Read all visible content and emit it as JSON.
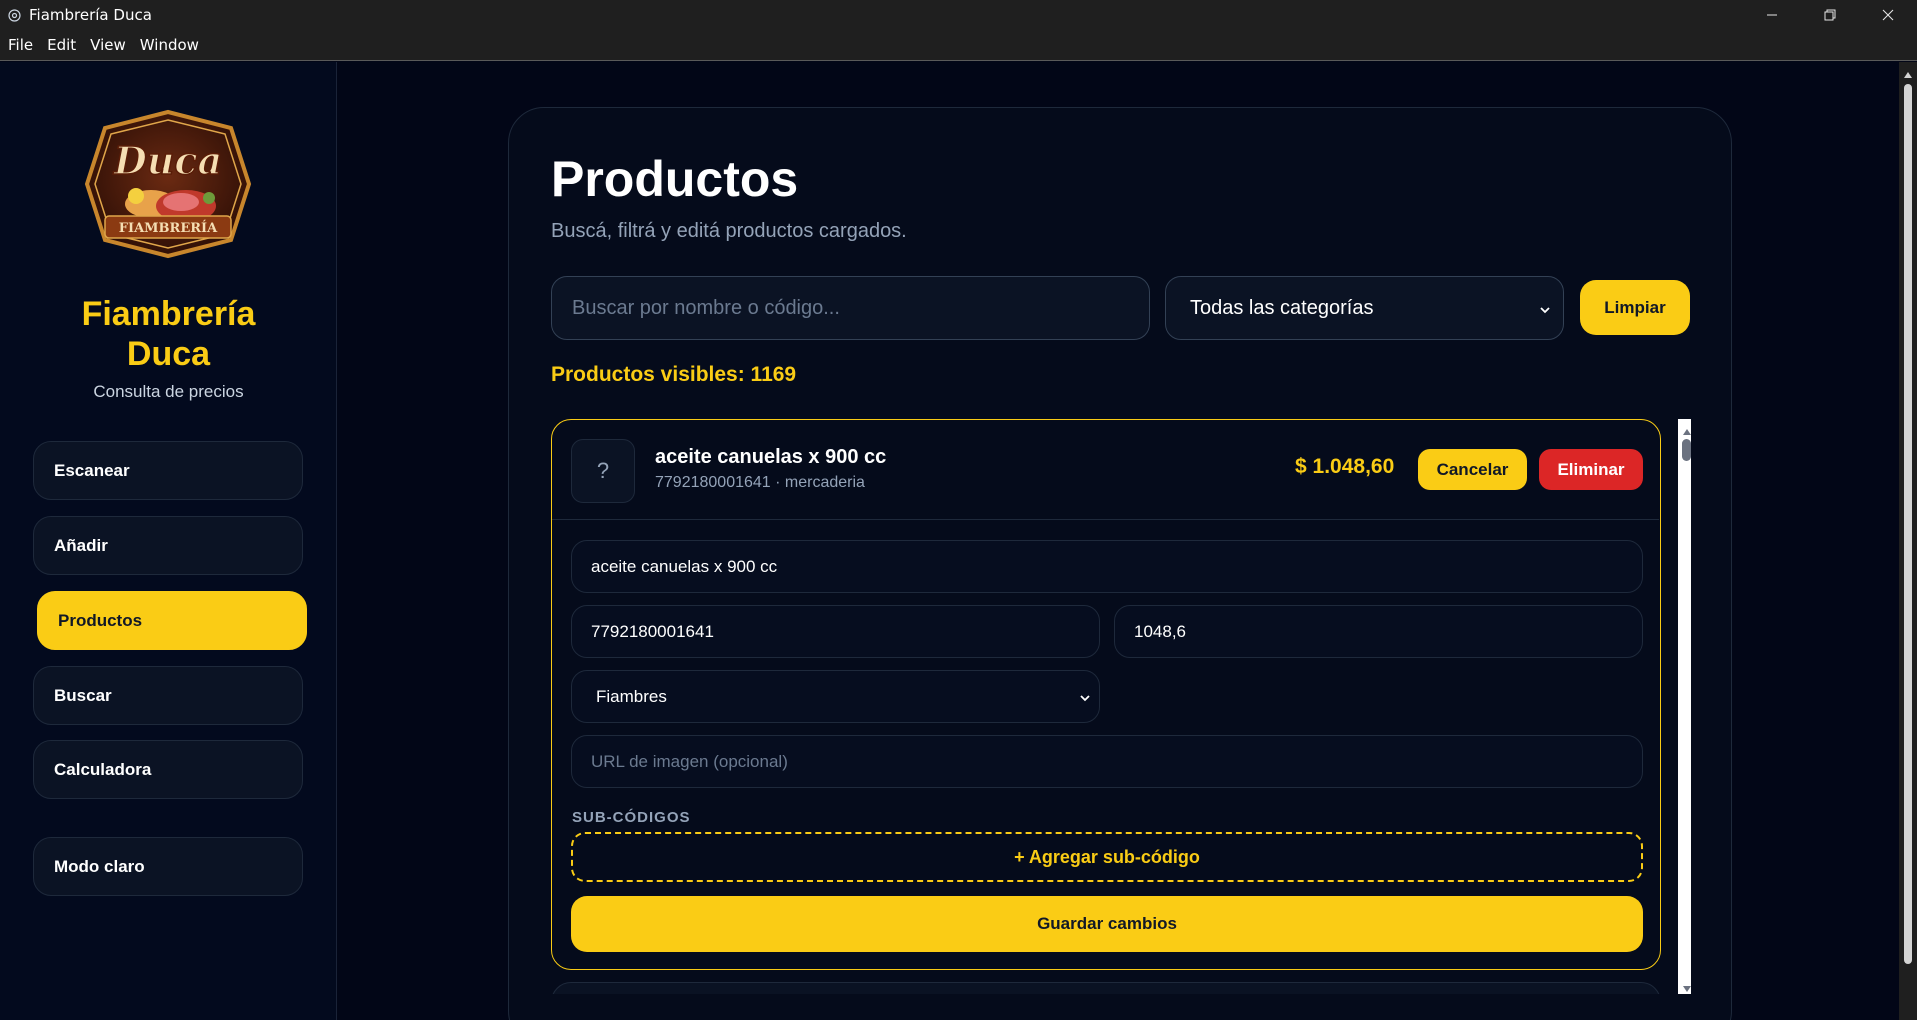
{
  "window": {
    "title": "Fiambrería Duca",
    "controls": [
      "minimize-icon",
      "restore-icon",
      "close-icon"
    ]
  },
  "menubar": {
    "items": [
      "File",
      "Edit",
      "View",
      "Window"
    ]
  },
  "sidebar": {
    "logo": {
      "text_top": "Duca",
      "text_banner": "FIAMBRERÍA"
    },
    "brand_line1": "Fiambrería",
    "brand_line2": "Duca",
    "brand_sub": "Consulta de precios",
    "items": [
      {
        "label": "Escanear",
        "active": false
      },
      {
        "label": "Añadir",
        "active": false
      },
      {
        "label": "Productos",
        "active": true
      },
      {
        "label": "Buscar",
        "active": false
      },
      {
        "label": "Calculadora",
        "active": false
      },
      {
        "label": "Modo claro",
        "active": false
      }
    ]
  },
  "main": {
    "title": "Productos",
    "subtitle": "Buscá, filtrá y editá productos cargados.",
    "search_placeholder": "Buscar por nombre o código...",
    "category_selected": "Todas las categorías",
    "clear_label": "Limpiar",
    "count_label": "Productos visibles: 1169"
  },
  "product": {
    "thumb_placeholder": "?",
    "name": "aceite canuelas x 900 cc",
    "meta": "7792180001641 · mercaderia",
    "price_display": "$ 1.048,60",
    "cancel_label": "Cancelar",
    "delete_label": "Eliminar",
    "form": {
      "name_value": "aceite canuelas x 900 cc",
      "code_value": "7792180001641",
      "price_value": "1048,6",
      "category_value": "Fiambres",
      "image_placeholder": "URL de imagen (opcional)",
      "subcodes_label": "SUB-CÓDIGOS",
      "add_subcode_label": "+ Agregar sub-código",
      "save_label": "Guardar cambios"
    }
  },
  "colors": {
    "accent": "#facc15",
    "danger": "#dc2626",
    "background": "#020617",
    "surface": "#0b1324"
  }
}
